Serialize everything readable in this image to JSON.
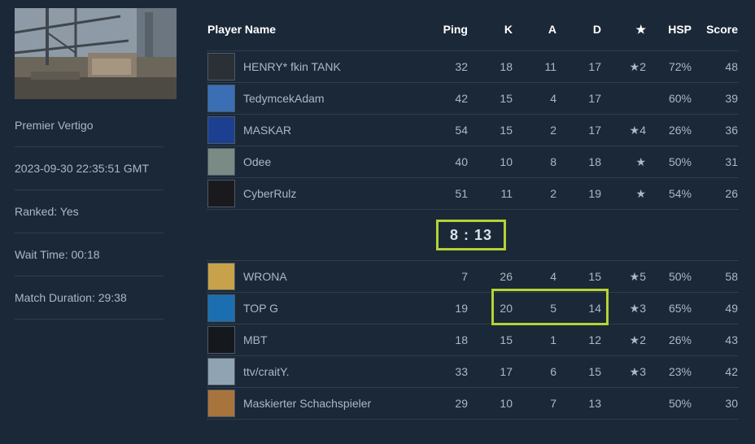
{
  "match": {
    "map_name": "Premier Vertigo",
    "timestamp": "2023-09-30 22:35:51 GMT",
    "ranked": "Ranked: Yes",
    "wait_time": "Wait Time: 00:18",
    "duration": "Match Duration: 29:38"
  },
  "headers": {
    "player": "Player Name",
    "ping": "Ping",
    "k": "K",
    "a": "A",
    "d": "D",
    "star": "★",
    "hsp": "HSP",
    "score": "Score"
  },
  "score": "8 : 13",
  "team1": [
    {
      "name": "HENRY* fkin TANK",
      "ping": "32",
      "k": "18",
      "a": "11",
      "d": "17",
      "star": "★2",
      "hsp": "72%",
      "score": "48",
      "avatar_color": "#2b2f36"
    },
    {
      "name": "TedymcekAdam",
      "ping": "42",
      "k": "15",
      "a": "4",
      "d": "17",
      "star": "",
      "hsp": "60%",
      "score": "39",
      "avatar_color": "#3a6fb5"
    },
    {
      "name": "MASKAR",
      "ping": "54",
      "k": "15",
      "a": "2",
      "d": "17",
      "star": "★4",
      "hsp": "26%",
      "score": "36",
      "avatar_color": "#1d3f8f"
    },
    {
      "name": "Odee",
      "ping": "40",
      "k": "10",
      "a": "8",
      "d": "18",
      "star": "★",
      "hsp": "50%",
      "score": "31",
      "avatar_color": "#7a8a84"
    },
    {
      "name": "CyberRulz",
      "ping": "51",
      "k": "11",
      "a": "2",
      "d": "19",
      "star": "★",
      "hsp": "54%",
      "score": "26",
      "avatar_color": "#1a1a1e"
    }
  ],
  "team2": [
    {
      "name": "WRONA",
      "ping": "7",
      "k": "26",
      "a": "4",
      "d": "15",
      "star": "★5",
      "hsp": "50%",
      "score": "58",
      "avatar_color": "#c7a24a"
    },
    {
      "name": "TOP G",
      "ping": "19",
      "k": "20",
      "a": "5",
      "d": "14",
      "star": "★3",
      "hsp": "65%",
      "score": "49",
      "avatar_color": "#1b6fb0"
    },
    {
      "name": "MBT",
      "ping": "18",
      "k": "15",
      "a": "1",
      "d": "12",
      "star": "★2",
      "hsp": "26%",
      "score": "43",
      "avatar_color": "#15181c"
    },
    {
      "name": "ttv/craitY.",
      "ping": "33",
      "k": "17",
      "a": "6",
      "d": "15",
      "star": "★3",
      "hsp": "23%",
      "score": "42",
      "avatar_color": "#8fa3b2"
    },
    {
      "name": "Maskierter Schachspieler",
      "ping": "29",
      "k": "10",
      "a": "7",
      "d": "13",
      "star": "",
      "hsp": "50%",
      "score": "30",
      "avatar_color": "#a8743e"
    }
  ],
  "colors": {
    "background": "#1b2838",
    "highlight": "#b5d334",
    "text": "#acb8c3"
  }
}
